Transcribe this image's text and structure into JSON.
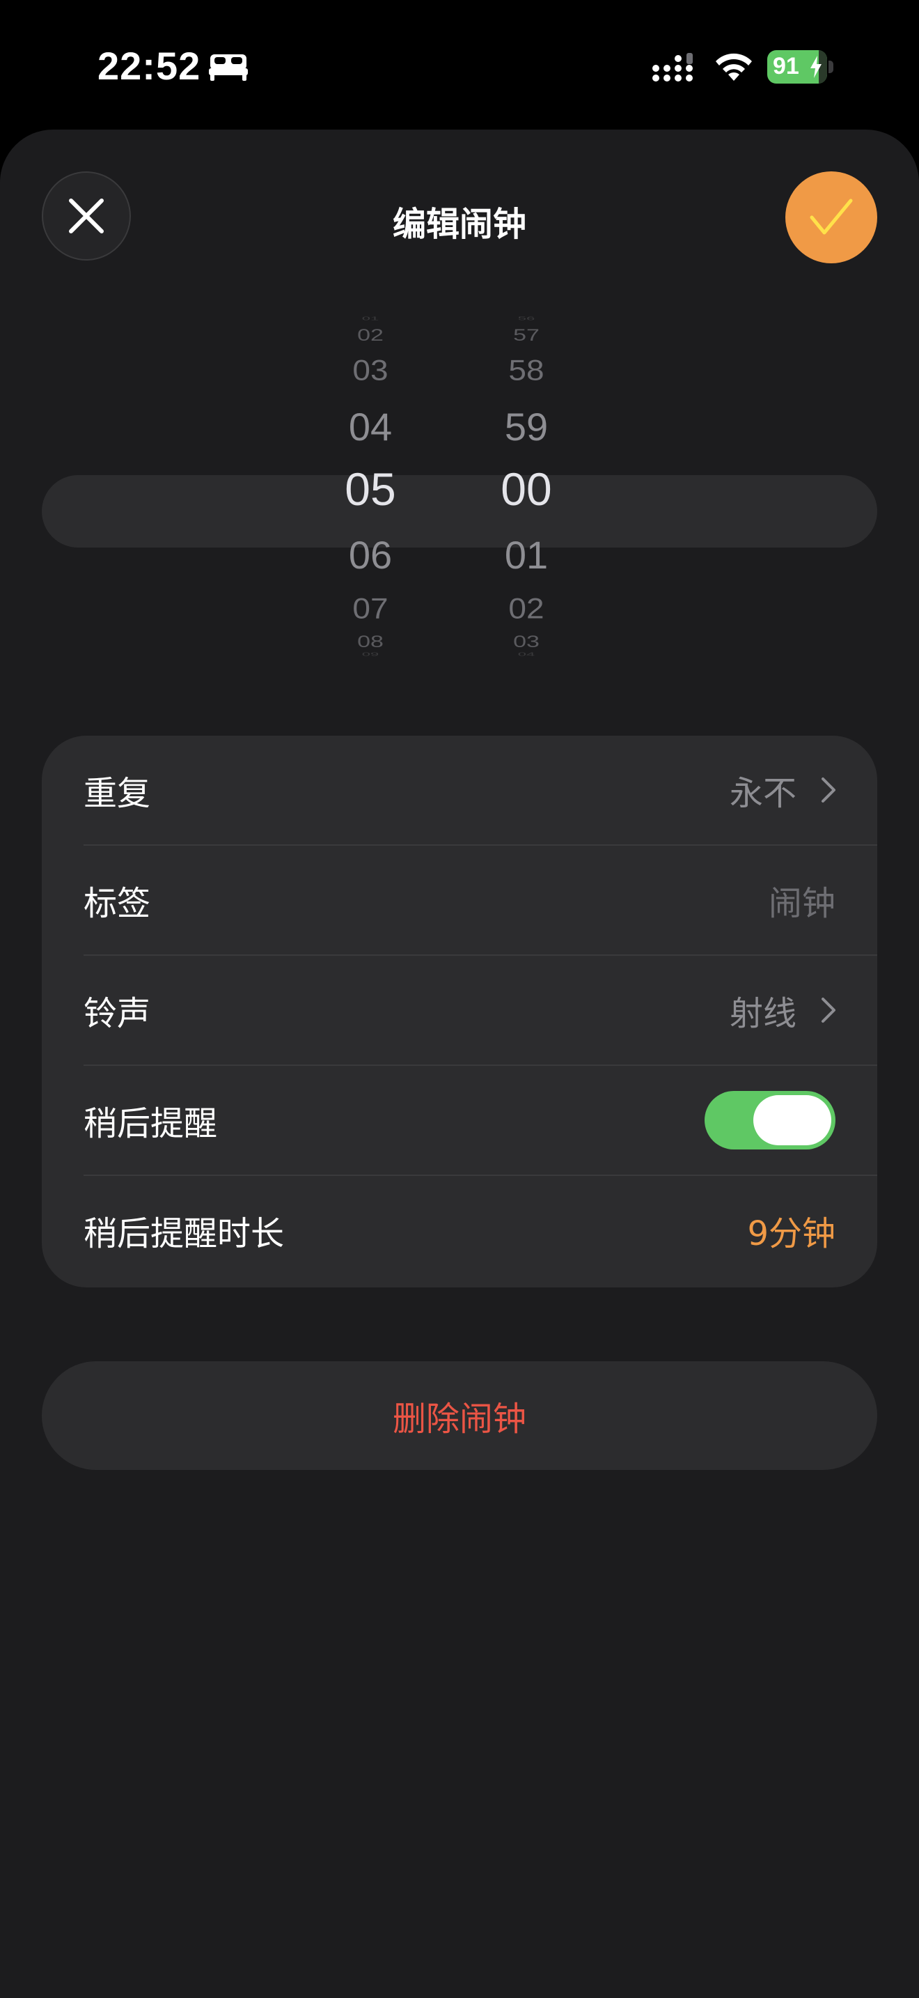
{
  "status_bar": {
    "time": "22:52",
    "battery_level": "91",
    "icons": [
      "bed-icon",
      "cellular-signal-icon",
      "wifi-icon",
      "battery-charging-icon"
    ]
  },
  "header": {
    "title": "编辑闹钟",
    "close_icon": "close-icon",
    "confirm_icon": "checkmark-icon"
  },
  "picker": {
    "hours": [
      "01",
      "02",
      "03",
      "04",
      "05",
      "06",
      "07",
      "08",
      "09"
    ],
    "minutes": [
      "56",
      "57",
      "58",
      "59",
      "00",
      "01",
      "02",
      "03",
      "04"
    ],
    "selected_hour": "05",
    "selected_minute": "00"
  },
  "settings": {
    "repeat": {
      "label": "重复",
      "value": "永不"
    },
    "label": {
      "label": "标签",
      "placeholder": "闹钟"
    },
    "sound": {
      "label": "铃声",
      "value": "射线"
    },
    "snooze": {
      "label": "稍后提醒",
      "enabled": true
    },
    "snooze_duration": {
      "label": "稍后提醒时长",
      "value": "9分钟"
    }
  },
  "delete_button": {
    "label": "删除闹钟"
  },
  "colors": {
    "accent_orange": "#f09a46",
    "toggle_green": "#5fc864",
    "destructive_red": "#eb5545",
    "sheet_background": "#1c1c1e",
    "group_background": "#2c2c2e"
  }
}
